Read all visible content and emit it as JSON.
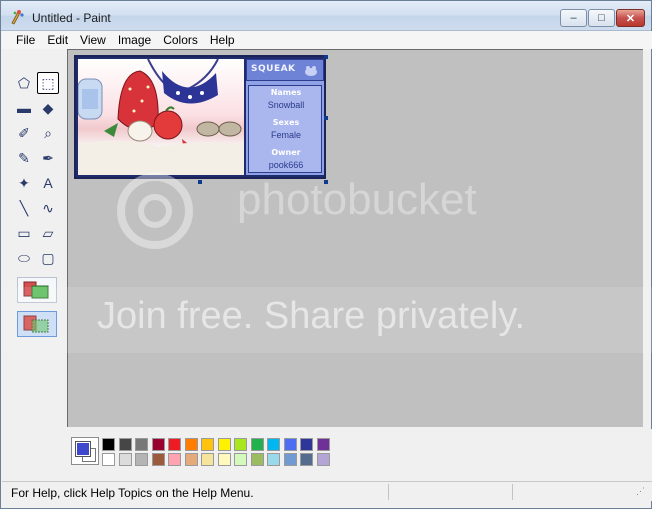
{
  "window": {
    "title": "Untitled - Paint",
    "minimize_glyph": "–",
    "maximize_glyph": "□",
    "close_glyph": "✕"
  },
  "menu": [
    "File",
    "Edit",
    "View",
    "Image",
    "Colors",
    "Help"
  ],
  "tools": [
    {
      "name": "free-form-select-icon",
      "glyph": "⬠"
    },
    {
      "name": "rect-select-icon",
      "glyph": "⬚"
    },
    {
      "name": "eraser-icon",
      "glyph": "▬"
    },
    {
      "name": "fill-bucket-icon",
      "glyph": "◆"
    },
    {
      "name": "color-picker-icon",
      "glyph": "✐"
    },
    {
      "name": "magnifier-icon",
      "glyph": "⌕"
    },
    {
      "name": "pencil-icon",
      "glyph": "✎"
    },
    {
      "name": "brush-icon",
      "glyph": "✒"
    },
    {
      "name": "airbrush-icon",
      "glyph": "✦"
    },
    {
      "name": "text-icon",
      "glyph": "A"
    },
    {
      "name": "line-icon",
      "glyph": "╲"
    },
    {
      "name": "curve-icon",
      "glyph": "∿"
    },
    {
      "name": "rectangle-icon",
      "glyph": "▭"
    },
    {
      "name": "polygon-icon",
      "glyph": "▱"
    },
    {
      "name": "ellipse-icon",
      "glyph": "⬭"
    },
    {
      "name": "rounded-rect-icon",
      "glyph": "▢"
    }
  ],
  "selected_tool": "rect-select-icon",
  "image": {
    "banner": "SQUEAK",
    "name_label": "Names",
    "name_value": "Snowball",
    "sex_label": "Sexes",
    "sex_value": "Female",
    "owner_label": "Owner",
    "owner_value": "pook666"
  },
  "watermark": {
    "brand": "photobucket",
    "tagline": "Join free. Share privately."
  },
  "colors": {
    "foreground": "#3f48cc",
    "background": "#ffffff",
    "palette_top": [
      "#000000",
      "#464646",
      "#787878",
      "#990030",
      "#ed1c24",
      "#ff7e00",
      "#ffc20e",
      "#fff200",
      "#a8e61d",
      "#22b14c",
      "#00b7ef",
      "#4d6df3",
      "#2f3699",
      "#6f3198"
    ],
    "palette_bottom": [
      "#ffffff",
      "#dcdcdc",
      "#b4b4b4",
      "#9c5a3c",
      "#ffa3b1",
      "#e5aa7a",
      "#f5e49c",
      "#fff9bd",
      "#d3f9bc",
      "#9dbb61",
      "#99d9ea",
      "#709ad1",
      "#546d8e",
      "#b5a5d5"
    ]
  },
  "status": {
    "text": "For Help, click Help Topics on the Help Menu."
  }
}
